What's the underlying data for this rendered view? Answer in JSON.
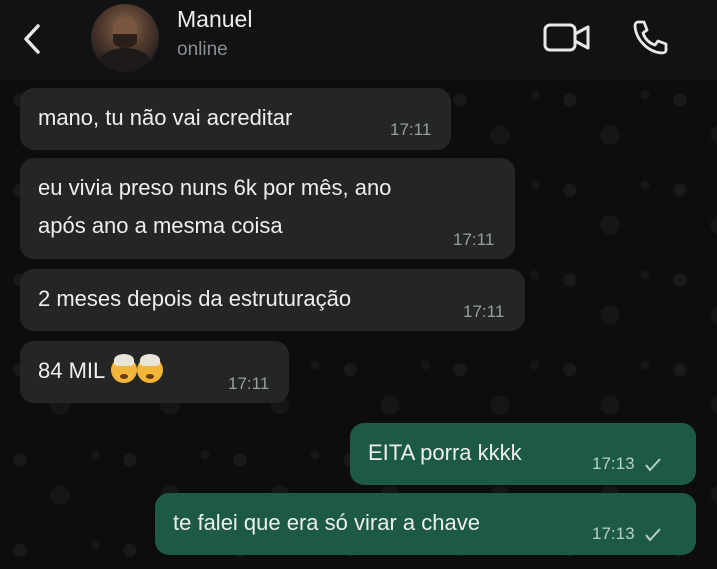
{
  "header": {
    "contact_name": "Manuel",
    "contact_status": "online",
    "icons": [
      "back-arrow-icon",
      "video-call-icon",
      "phone-icon"
    ]
  },
  "colors": {
    "header_bg": "#111213",
    "incoming_bubble": "#242626",
    "outgoing_bubble": "#1c5a44"
  },
  "messages": [
    {
      "direction": "incoming",
      "lines": [
        "mano, tu não vai acreditar"
      ],
      "time": "17:11"
    },
    {
      "direction": "incoming",
      "lines": [
        "eu vivia preso nuns 6k por mês, ano",
        "após ano a mesma coisa"
      ],
      "time": "17:11"
    },
    {
      "direction": "incoming",
      "lines": [
        "2 meses depois da estruturação"
      ],
      "time": "17:11"
    },
    {
      "direction": "incoming",
      "lines": [
        "84 MIL"
      ],
      "emoji": [
        "exploding-head-emoji",
        "exploding-head-emoji"
      ],
      "time": "17:11"
    },
    {
      "direction": "outgoing",
      "lines": [
        "EITA porra kkkk"
      ],
      "time": "17:13",
      "status": "sent"
    },
    {
      "direction": "outgoing",
      "lines": [
        "te falei que era só virar a chave"
      ],
      "time": "17:13",
      "status": "sent"
    }
  ]
}
